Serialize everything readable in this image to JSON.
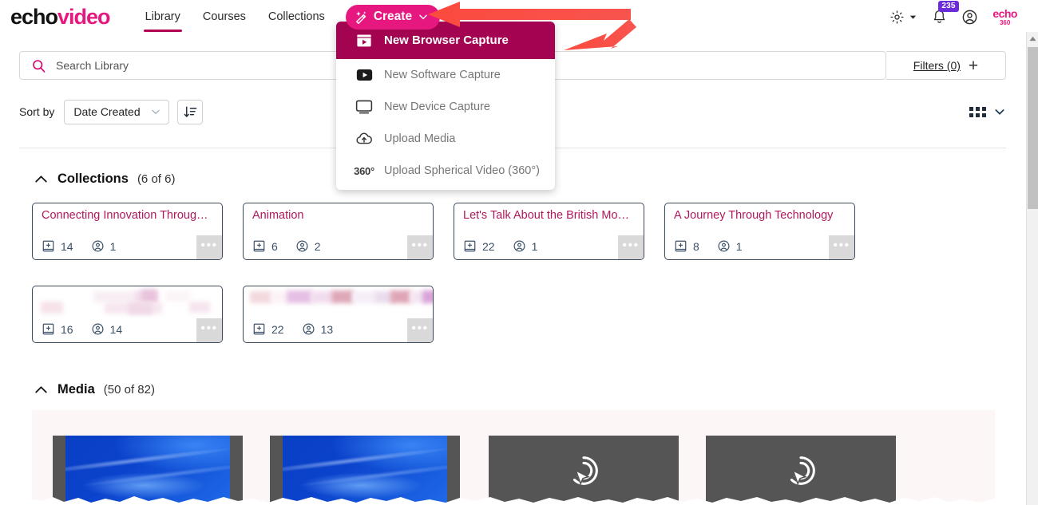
{
  "brand": {
    "logo_echo": "echo",
    "logo_video": "video",
    "corner_logo_top": "echo",
    "corner_logo_bottom": "360",
    "accent_pink": "#E6177E",
    "accent_dark_magenta": "#A30351",
    "link_pink": "#B0185C",
    "badge_purple": "#6C2BD9",
    "arrow_red": "#FB4B41"
  },
  "nav": {
    "tabs": [
      {
        "label": "Library",
        "active": true
      },
      {
        "label": "Courses",
        "active": false
      },
      {
        "label": "Collections",
        "active": false
      }
    ],
    "create_button": {
      "label": "Create",
      "icon": "magic-wand-icon",
      "chevron": "chevron-down-icon"
    },
    "right_icons": {
      "settings": "gear-icon",
      "settings_caret": "caret-down-icon",
      "notifications": "bell-icon",
      "notification_count": "235",
      "profile": "user-circle-icon"
    }
  },
  "create_menu": {
    "items": [
      {
        "label": "New Browser Capture",
        "icon": "browser-capture-icon",
        "selected": true
      },
      {
        "label": "New Software Capture",
        "icon": "software-capture-icon",
        "selected": false
      },
      {
        "label": "New Device Capture",
        "icon": "device-monitor-icon",
        "selected": false
      },
      {
        "label": "Upload Media",
        "icon": "cloud-upload-icon",
        "selected": false
      },
      {
        "label": "Upload Spherical Video (360°)",
        "icon": "360-icon",
        "selected": false
      }
    ]
  },
  "search": {
    "placeholder": "Search Library",
    "icon": "search-icon",
    "filters_label": "Filters (0)",
    "filters_add_icon": "plus-icon"
  },
  "sort": {
    "label": "Sort by",
    "selected": "Date Created",
    "options": [
      "Date Created"
    ],
    "chevron": "chevron-down-icon",
    "direction_icon": "sort-descending-icon",
    "view_icon": "grid-view-icon",
    "view_chevron": "chevron-down-icon"
  },
  "collections": {
    "title": "Collections",
    "count": "(6 of 6)",
    "collapse_icon": "chevron-up-icon",
    "cards": [
      {
        "title": "Connecting Innovation Throug…",
        "media_count": "14",
        "user_count": "1",
        "redacted": false
      },
      {
        "title": "Animation",
        "media_count": "6",
        "user_count": "2",
        "redacted": false
      },
      {
        "title": "Let's Talk About the British Mo…",
        "media_count": "22",
        "user_count": "1",
        "redacted": false
      },
      {
        "title": "A Journey Through Technology",
        "media_count": "8",
        "user_count": "1",
        "redacted": false
      },
      {
        "title": "",
        "media_count": "16",
        "user_count": "14",
        "redacted": true
      },
      {
        "title": "",
        "media_count": "22",
        "user_count": "13",
        "redacted": true
      }
    ],
    "media_icon": "media-collection-icon",
    "user_icon": "user-circle-icon",
    "more_icon": "more-options-icon",
    "more_label": "•••"
  },
  "media": {
    "title": "Media",
    "count": "(50 of 82)",
    "collapse_icon": "chevron-up-icon",
    "thumbnails": [
      {
        "type": "blue-gradient"
      },
      {
        "type": "blue-gradient"
      },
      {
        "type": "gray-capture",
        "icon": "screen-capture-cursor-icon"
      },
      {
        "type": "gray-capture",
        "icon": "screen-capture-cursor-icon"
      }
    ]
  },
  "annotations": {
    "arrow_1": "horizontal-arrow-pointing-to-create-button",
    "arrow_2": "diagonal-arrow-pointing-to-new-browser-capture"
  },
  "scrollbar": {
    "up_arrow": "scroll-up-arrow-icon"
  }
}
